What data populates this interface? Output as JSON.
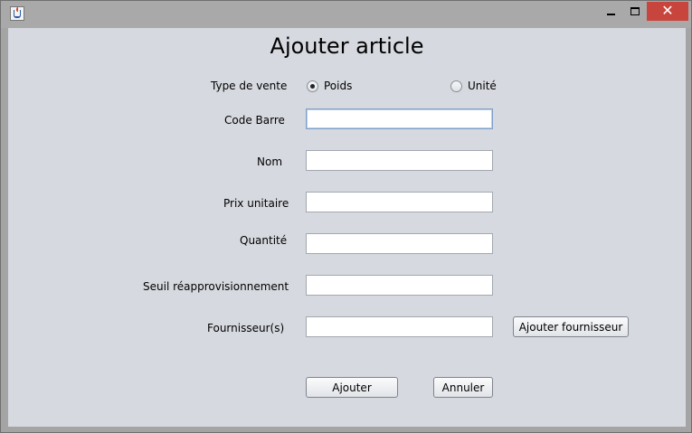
{
  "window": {
    "icon": "java-cup-icon",
    "controls": {
      "minimize": "minimize-icon",
      "maximize": "maximize-icon",
      "close_label": "✕"
    }
  },
  "form": {
    "title": "Ajouter article",
    "sale_type": {
      "label": "Type de vente",
      "options": [
        {
          "label": "Poids",
          "checked": true
        },
        {
          "label": "Unité",
          "checked": false
        }
      ]
    },
    "fields": {
      "barcode": {
        "label": "Code Barre",
        "value": ""
      },
      "name": {
        "label": "Nom",
        "value": ""
      },
      "unit_price": {
        "label": "Prix unitaire",
        "value": ""
      },
      "quantity": {
        "label": "Quantité",
        "value": ""
      },
      "reorder_threshold": {
        "label": "Seuil réapprovisionnement",
        "value": ""
      },
      "suppliers": {
        "label": "Fournisseur(s)",
        "value": ""
      }
    },
    "buttons": {
      "add_supplier": "Ajouter fournisseur",
      "add": "Ajouter",
      "cancel": "Annuler"
    }
  },
  "colors": {
    "client_bg": "#d6d9df",
    "titlebar_bg": "#a9a9a9",
    "close_bg": "#c8453d"
  }
}
